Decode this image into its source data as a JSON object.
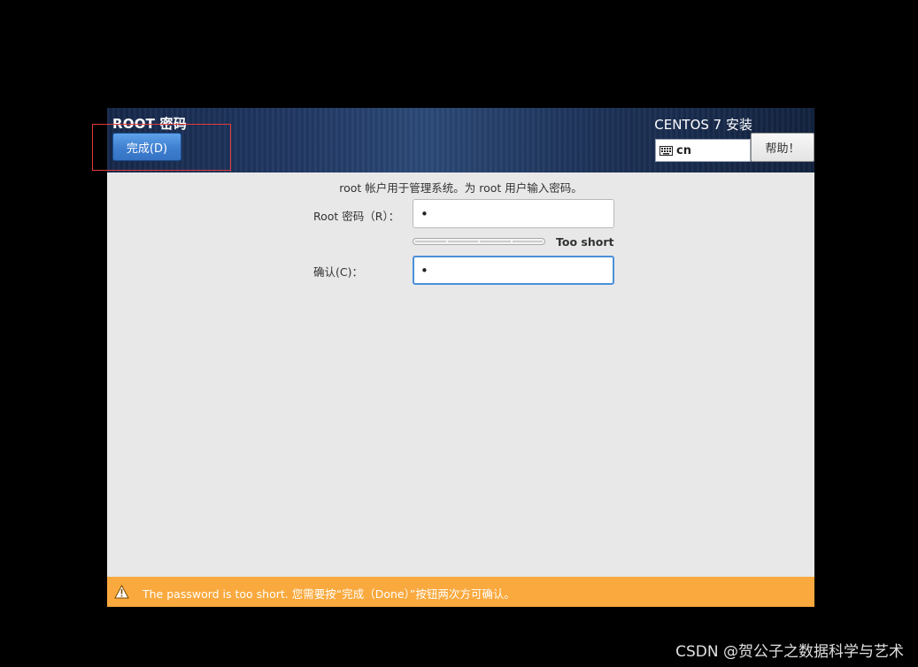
{
  "header": {
    "page_title": "ROOT 密码",
    "done_label": "完成(D)",
    "product_title": "CENTOS 7 安装",
    "keyboard_layout": "cn",
    "help_label": "帮助！"
  },
  "form": {
    "description": "root 帐户用于管理系统。为 root 用户输入密码。",
    "password_label": "Root 密码（R）：",
    "password_value": "•",
    "strength_label": "Too short",
    "strength_fraction": 0,
    "confirm_label": "确认(C)：",
    "confirm_value": "•"
  },
  "status": {
    "warning_text": "The password is too short. 您需要按“完成（Done）”按钮两次方可确认。"
  },
  "watermark": "CSDN @贺公子之数据科学与艺术",
  "colors": {
    "status_bar": "#f9a93d",
    "done_button": "#3f7fd0",
    "focus_ring": "#4a90d9",
    "highlight_box": "#e23b3b"
  }
}
